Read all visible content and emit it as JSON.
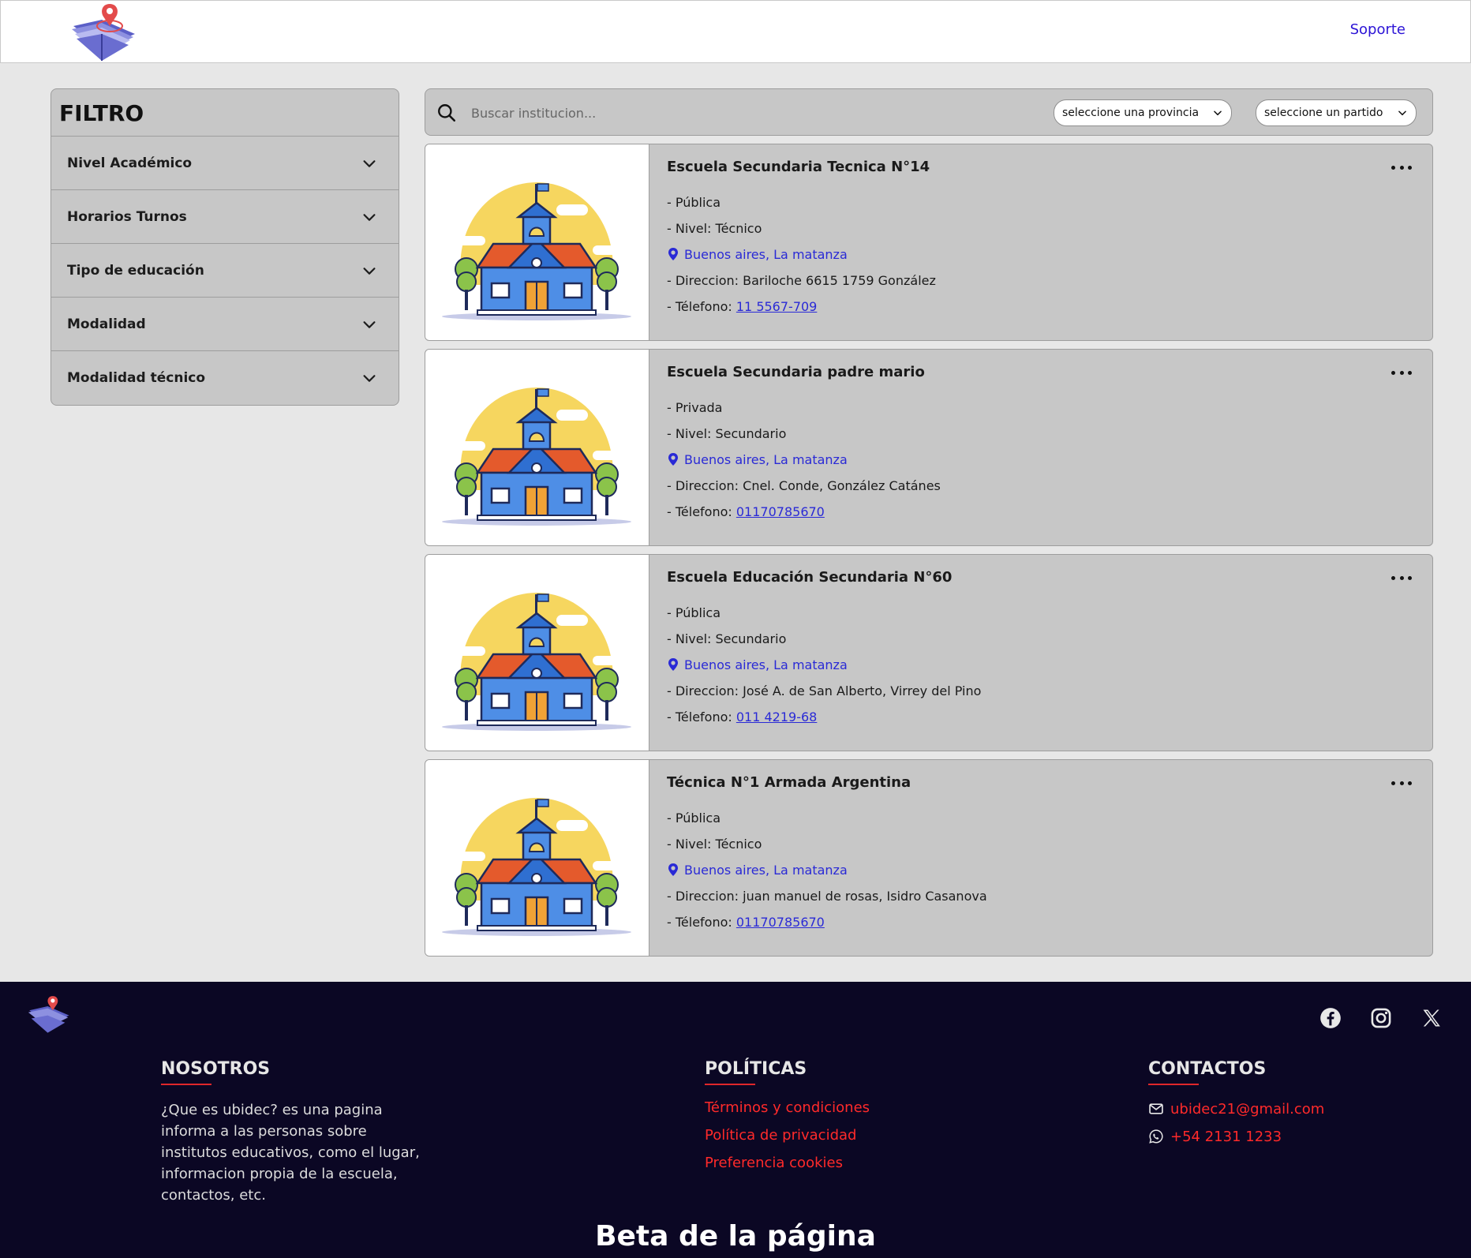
{
  "header": {
    "support_label": "Soporte"
  },
  "filter": {
    "title": "FILTRO",
    "items": [
      {
        "label": "Nivel Académico"
      },
      {
        "label": "Horarios Turnos"
      },
      {
        "label": "Tipo de educación"
      },
      {
        "label": "Modalidad"
      },
      {
        "label": "Modalidad técnico"
      }
    ]
  },
  "search": {
    "placeholder": "Buscar institucion...",
    "province_select": "seleccione una provincia",
    "district_select": "seleccione un partido"
  },
  "schools": [
    {
      "name": "Escuela Secundaria Tecnica N°14",
      "type": "- Pública",
      "level": "- Nivel: Técnico",
      "location": "Buenos aires, La matanza",
      "address": "- Direccion: Bariloche 6615 1759 González",
      "phone_label": "- Télefono: ",
      "phone": "11 5567-709"
    },
    {
      "name": "Escuela Secundaria padre mario",
      "type": "- Privada",
      "level": "- Nivel: Secundario",
      "location": "Buenos aires, La matanza",
      "address": "- Direccion: Cnel. Conde, González Catánes",
      "phone_label": "- Télefono: ",
      "phone": "01170785670"
    },
    {
      "name": "Escuela Educación Secundaria N°60",
      "type": "- Pública",
      "level": "- Nivel: Secundario",
      "location": "Buenos aires, La matanza",
      "address": "- Direccion: José A. de San Alberto, Virrey del Pino",
      "phone_label": "- Télefono: ",
      "phone": "011 4219-68"
    },
    {
      "name": "Técnica N°1 Armada Argentina",
      "type": "- Pública",
      "level": "- Nivel: Técnico",
      "location": "Buenos aires, La matanza",
      "address": "- Direccion: juan manuel de rosas, Isidro Casanova",
      "phone_label": "- Télefono: ",
      "phone": "01170785670"
    }
  ],
  "footer": {
    "about": {
      "title": "NOSOTROS",
      "text": "¿Que es ubidec? es una pagina informa a las personas sobre institutos educativos, como el lugar, informacion propia de la escuela, contactos, etc."
    },
    "policies": {
      "title": "POLÍTICAS",
      "links": [
        "Términos y condiciones",
        "Política de privacidad",
        "Preferencia cookies"
      ]
    },
    "contacts": {
      "title": "CONTACTOS",
      "email": "ubidec21@gmail.com",
      "phone": "+54 2131 1233"
    },
    "beta": "Beta de la página",
    "socials": [
      "facebook-icon",
      "instagram-icon",
      "x-icon"
    ]
  },
  "colors": {
    "accent_link": "#2a2ad6",
    "footer_bg": "#0b0724",
    "footer_link": "#ff2a2a",
    "panel_bg": "#c7c7c7"
  }
}
